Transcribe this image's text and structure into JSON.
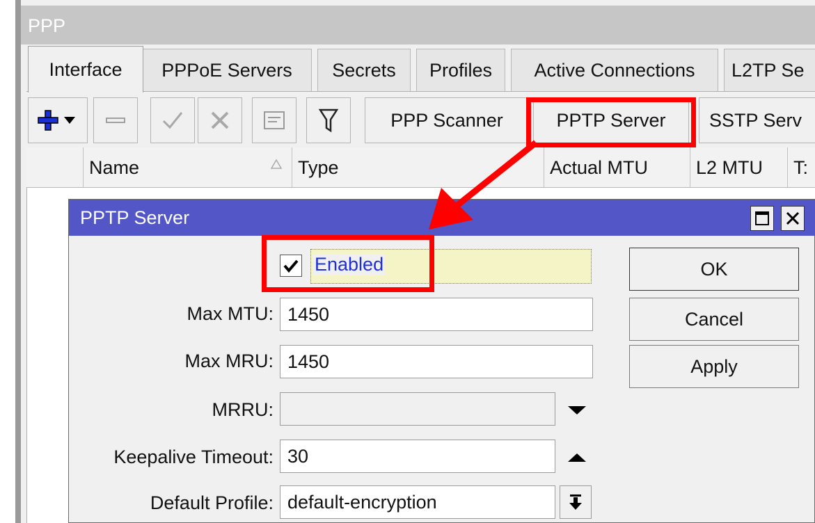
{
  "window": {
    "title": "PPP"
  },
  "tabs": [
    {
      "label": "Interface",
      "active": true
    },
    {
      "label": "PPPoE Servers"
    },
    {
      "label": "Secrets"
    },
    {
      "label": "Profiles"
    },
    {
      "label": "Active Connections"
    },
    {
      "label": "L2TP Se"
    }
  ],
  "toolbar": {
    "add_icon": "plus-icon",
    "dropdown_icon": "triangle-down-icon",
    "remove_icon": "minus-icon",
    "enable_icon": "check-icon",
    "disable_icon": "cross-icon",
    "comment_icon": "note-icon",
    "filter_icon": "filter-icon",
    "ppp_scanner_label": "PPP Scanner",
    "pptp_server_label": "PPTP Server",
    "sstp_server_label": "SSTP Serv"
  },
  "list": {
    "columns": [
      "Name",
      "Type",
      "Actual MTU",
      "L2 MTU",
      "T:"
    ],
    "sort_icon": "sort-asc-icon"
  },
  "dialog": {
    "title": "PPTP Server",
    "maximize_icon": "maximize-icon",
    "close_icon": "close-icon",
    "enabled_label": "Enabled",
    "enabled_checked": true,
    "fields": {
      "max_mtu": {
        "label": "Max MTU:",
        "value": "1450"
      },
      "max_mru": {
        "label": "Max MRU:",
        "value": "1450"
      },
      "mrru": {
        "label": "MRRU:",
        "value": ""
      },
      "keepalive": {
        "label": "Keepalive Timeout:",
        "value": "30"
      },
      "default_profile": {
        "label": "Default Profile:",
        "value": "default-encryption"
      }
    },
    "buttons": {
      "ok": "OK",
      "cancel": "Cancel",
      "apply": "Apply"
    }
  },
  "annotation": {
    "color": "#ff0000"
  }
}
